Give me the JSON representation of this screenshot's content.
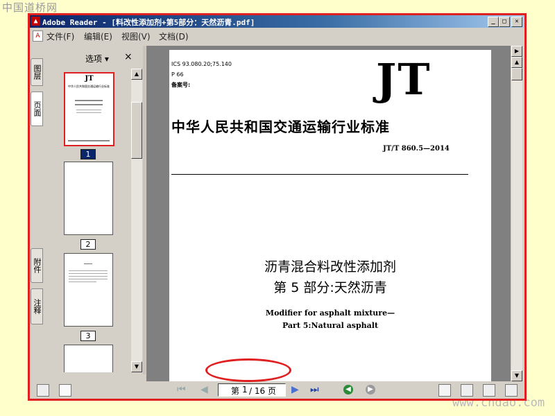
{
  "watermark_top": "中国道桥网",
  "watermark_bottom": "www.cndao.com",
  "window": {
    "title": "Adobe Reader - [料改性添加剂+第5部分：天然沥青.pdf]"
  },
  "menu": {
    "items": [
      "文件(F)",
      "编辑(E)",
      "视图(V)",
      "文档(D)"
    ]
  },
  "side_tabs": [
    "图层",
    "页面",
    "附件",
    "注释"
  ],
  "nav_panel": {
    "options_label": "选项 ▾",
    "close_label": "×",
    "thumbnails": [
      {
        "label": "1",
        "selected": true
      },
      {
        "label": "2",
        "selected": false
      },
      {
        "label": "3",
        "selected": false
      }
    ],
    "thumb1_logo": "JT",
    "thumb1_title": "中华人民共和国交通运输行业标准"
  },
  "document": {
    "ics": "ICS 93.080.20;75.140",
    "p": "P 66",
    "record_no": "备案号:",
    "logo": "JT",
    "org_title": "中华人民共和国交通运输行业标准",
    "std_no": "JT/T 860.5—2014",
    "title_cn_1": "沥青混合料改性添加剂",
    "title_cn_2": "第 5 部分:天然沥青",
    "title_en_1": "Modifier for asphalt mixture—",
    "title_en_2": "Part 5:Natural asphalt"
  },
  "status": {
    "page_field": "第 1 / 16 页",
    "page_prefix": "第",
    "current_page": "1",
    "total": "/ 16 页"
  },
  "colors": {
    "highlight": "#e02020",
    "titlebar": "#0a246a",
    "background": "#ffffcc"
  }
}
